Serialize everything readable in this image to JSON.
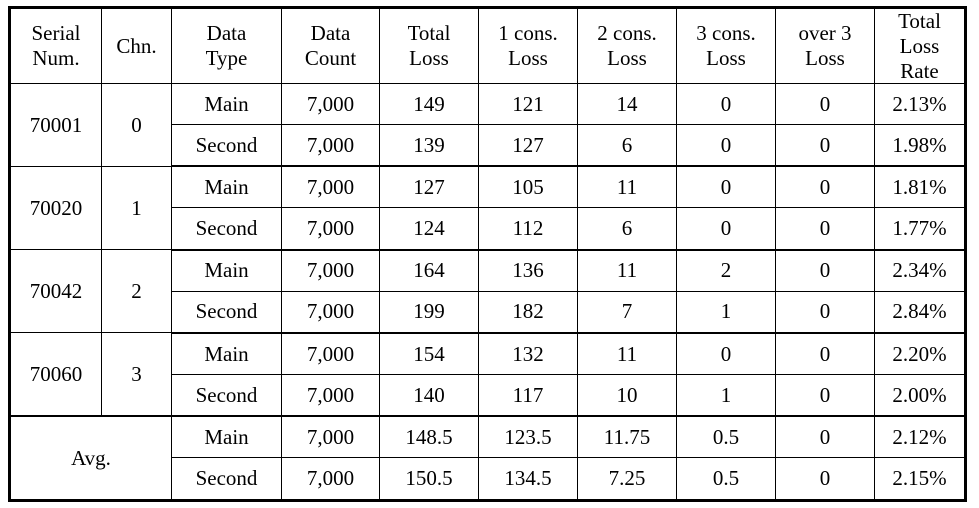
{
  "table": {
    "headers": [
      {
        "id": "serial-num",
        "lines": [
          "Serial",
          "Num."
        ]
      },
      {
        "id": "chn",
        "lines": [
          "Chn."
        ]
      },
      {
        "id": "data-type",
        "lines": [
          "Data",
          "Type"
        ]
      },
      {
        "id": "data-count",
        "lines": [
          "Data",
          "Count"
        ]
      },
      {
        "id": "total-loss",
        "lines": [
          "Total",
          "Loss"
        ]
      },
      {
        "id": "1-cons-loss",
        "lines": [
          "1 cons.",
          "Loss"
        ]
      },
      {
        "id": "2-cons-loss",
        "lines": [
          "2 cons.",
          "Loss"
        ]
      },
      {
        "id": "3-cons-loss",
        "lines": [
          "3 cons.",
          "Loss"
        ]
      },
      {
        "id": "over-3-loss",
        "lines": [
          "over 3",
          "Loss"
        ]
      },
      {
        "id": "total-loss-rate",
        "lines": [
          "Total",
          "Loss",
          "Rate"
        ]
      }
    ],
    "groups": [
      {
        "serial": "70001",
        "chn": "0",
        "rows": [
          {
            "type": "Main",
            "count": "7,000",
            "total": "149",
            "c1": "121",
            "c2": "14",
            "c3": "0",
            "over3": "0",
            "rate": "2.13%"
          },
          {
            "type": "Second",
            "count": "7,000",
            "total": "139",
            "c1": "127",
            "c2": "6",
            "c3": "0",
            "over3": "0",
            "rate": "1.98%"
          }
        ]
      },
      {
        "serial": "70020",
        "chn": "1",
        "rows": [
          {
            "type": "Main",
            "count": "7,000",
            "total": "127",
            "c1": "105",
            "c2": "11",
            "c3": "0",
            "over3": "0",
            "rate": "1.81%"
          },
          {
            "type": "Second",
            "count": "7,000",
            "total": "124",
            "c1": "112",
            "c2": "6",
            "c3": "0",
            "over3": "0",
            "rate": "1.77%"
          }
        ]
      },
      {
        "serial": "70042",
        "chn": "2",
        "rows": [
          {
            "type": "Main",
            "count": "7,000",
            "total": "164",
            "c1": "136",
            "c2": "11",
            "c3": "2",
            "over3": "0",
            "rate": "2.34%"
          },
          {
            "type": "Second",
            "count": "7,000",
            "total": "199",
            "c1": "182",
            "c2": "7",
            "c3": "1",
            "over3": "0",
            "rate": "2.84%"
          }
        ]
      },
      {
        "serial": "70060",
        "chn": "3",
        "rows": [
          {
            "type": "Main",
            "count": "7,000",
            "total": "154",
            "c1": "132",
            "c2": "11",
            "c3": "0",
            "over3": "0",
            "rate": "2.20%"
          },
          {
            "type": "Second",
            "count": "7,000",
            "total": "140",
            "c1": "117",
            "c2": "10",
            "c3": "1",
            "over3": "0",
            "rate": "2.00%"
          }
        ]
      }
    ],
    "summary": {
      "label": "Avg.",
      "rows": [
        {
          "type": "Main",
          "count": "7,000",
          "total": "148.5",
          "c1": "123.5",
          "c2": "11.75",
          "c3": "0.5",
          "over3": "0",
          "rate": "2.12%"
        },
        {
          "type": "Second",
          "count": "7,000",
          "total": "150.5",
          "c1": "134.5",
          "c2": "7.25",
          "c3": "0.5",
          "over3": "0",
          "rate": "2.15%"
        }
      ]
    }
  },
  "chart_data": {
    "type": "table",
    "title": "",
    "columns": [
      "Serial Num.",
      "Chn.",
      "Data Type",
      "Data Count",
      "Total Loss",
      "1 cons. Loss",
      "2 cons. Loss",
      "3 cons. Loss",
      "over 3 Loss",
      "Total Loss Rate"
    ],
    "rows": [
      [
        "70001",
        "0",
        "Main",
        "7,000",
        "149",
        "121",
        "14",
        "0",
        "0",
        "2.13%"
      ],
      [
        "70001",
        "0",
        "Second",
        "7,000",
        "139",
        "127",
        "6",
        "0",
        "0",
        "1.98%"
      ],
      [
        "70020",
        "1",
        "Main",
        "7,000",
        "127",
        "105",
        "11",
        "0",
        "0",
        "1.81%"
      ],
      [
        "70020",
        "1",
        "Second",
        "7,000",
        "124",
        "112",
        "6",
        "0",
        "0",
        "1.77%"
      ],
      [
        "70042",
        "2",
        "Main",
        "7,000",
        "164",
        "136",
        "11",
        "2",
        "0",
        "2.34%"
      ],
      [
        "70042",
        "2",
        "Second",
        "7,000",
        "199",
        "182",
        "7",
        "1",
        "0",
        "2.84%"
      ],
      [
        "70060",
        "3",
        "Main",
        "7,000",
        "154",
        "132",
        "11",
        "0",
        "0",
        "2.20%"
      ],
      [
        "70060",
        "3",
        "Second",
        "7,000",
        "140",
        "117",
        "10",
        "1",
        "0",
        "2.00%"
      ],
      [
        "Avg.",
        "",
        "Main",
        "7,000",
        "148.5",
        "123.5",
        "11.75",
        "0.5",
        "0",
        "2.12%"
      ],
      [
        "Avg.",
        "",
        "Second",
        "7,000",
        "150.5",
        "134.5",
        "7.25",
        "0.5",
        "0",
        "2.15%"
      ]
    ]
  }
}
